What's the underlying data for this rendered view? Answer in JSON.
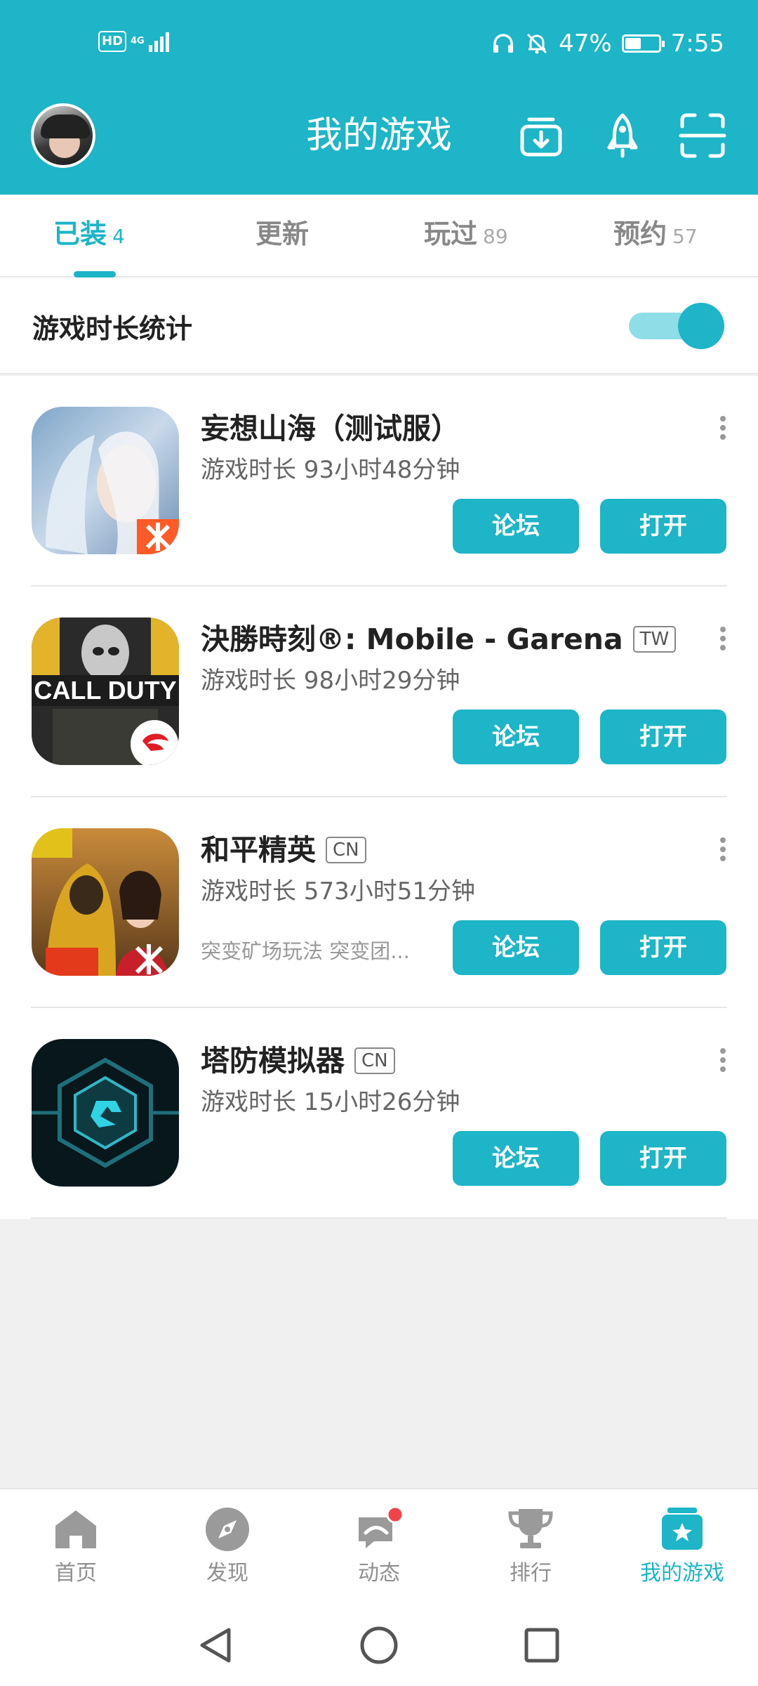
{
  "status_bar": {
    "hd": "HD",
    "network": "4G",
    "battery": "47%",
    "time": "7:55"
  },
  "app_bar": {
    "title": "我的游戏"
  },
  "tabs": [
    {
      "label": "已装",
      "count": "4"
    },
    {
      "label": "更新",
      "count": ""
    },
    {
      "label": "玩过",
      "count": "89"
    },
    {
      "label": "预约",
      "count": "57"
    }
  ],
  "playtime_stats": {
    "label": "游戏时长统计",
    "enabled": true
  },
  "games": [
    {
      "name": "妄想山海（测试服）",
      "region": "",
      "playtime": "游戏时长 93小时48分钟",
      "desc": "",
      "forum": "论坛",
      "open": "打开"
    },
    {
      "name": "決勝時刻®: Mobile - Garena",
      "region": "TW",
      "playtime": "游戏时长 98小时29分钟",
      "desc": "",
      "forum": "论坛",
      "open": "打开"
    },
    {
      "name": "和平精英",
      "region": "CN",
      "playtime": "游戏时长 573小时51分钟",
      "desc": "突变矿场玩法 突变团...",
      "forum": "论坛",
      "open": "打开"
    },
    {
      "name": "塔防模拟器",
      "region": "CN",
      "playtime": "游戏时长 15小时26分钟",
      "desc": "",
      "forum": "论坛",
      "open": "打开"
    }
  ],
  "bottom_nav": [
    {
      "label": "首页",
      "icon": "home-icon"
    },
    {
      "label": "发现",
      "icon": "compass-icon"
    },
    {
      "label": "动态",
      "icon": "chat-icon"
    },
    {
      "label": "排行",
      "icon": "trophy-icon"
    },
    {
      "label": "我的游戏",
      "icon": "my-games-icon"
    }
  ],
  "colors": {
    "accent": "#1db5c7",
    "page_bg": "#f0f0f0"
  }
}
